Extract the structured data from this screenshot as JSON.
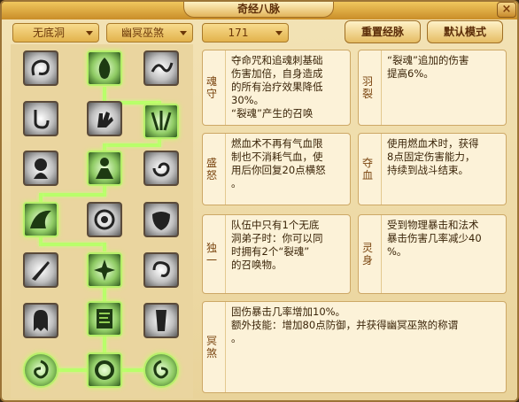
{
  "window": {
    "title": "奇经八脉",
    "close_glyph": "×"
  },
  "filters": [
    {
      "value": "无底洞"
    },
    {
      "value": "幽冥巫煞"
    },
    {
      "value": "171"
    }
  ],
  "buttons": {
    "reset": "重置经脉",
    "default_mode": "默认模式"
  },
  "cards": [
    {
      "label": "魂守",
      "lines": [
        "夺命咒和追魂刺基础",
        "伤害加倍，自身造成",
        "的所有治疗效果降低",
        "30%。",
        "“裂魂”产生的召唤"
      ]
    },
    {
      "label": "羽裂",
      "lines": [
        "“裂魂”追加的伤害",
        "提高6%。"
      ]
    },
    {
      "label": "盛怒",
      "lines": [
        "燃血术不再有气血限",
        "制也不消耗气血，使",
        "用后你回复20点横怒",
        "。"
      ]
    },
    {
      "label": "夺血",
      "lines": [
        "使用燃血术时，获得",
        "8点固定伤害能力，",
        "持续到战斗结束。"
      ]
    },
    {
      "label": "独一",
      "lines": [
        "队伍中只有1个无底",
        "洞弟子时：你可以同",
        "时拥有2个“裂魂”",
        "的召唤物。"
      ]
    },
    {
      "label": "灵身",
      "lines": [
        "受到物理暴击和法术",
        "暴击伤害几率减少40",
        "%。"
      ]
    },
    {
      "label": "冥煞",
      "lines": [
        "固伤暴击几率增加10%。",
        "额外技能：增加80点防御，并获得幽冥巫煞的称谓",
        "。"
      ]
    }
  ],
  "nodes": [
    {
      "name": "skill-r1-left",
      "active": false
    },
    {
      "name": "skill-r1-mid",
      "active": true
    },
    {
      "name": "skill-r1-right",
      "active": false
    },
    {
      "name": "skill-r2-left",
      "active": false
    },
    {
      "name": "skill-r2-mid",
      "active": false
    },
    {
      "name": "skill-r2-right",
      "active": true
    },
    {
      "name": "skill-r3-left",
      "active": false
    },
    {
      "name": "skill-r3-mid",
      "active": true
    },
    {
      "name": "skill-r3-right",
      "active": false
    },
    {
      "name": "skill-r4-left",
      "active": true
    },
    {
      "name": "skill-r4-mid",
      "active": false
    },
    {
      "name": "skill-r4-right",
      "active": false
    },
    {
      "name": "skill-r5-left",
      "active": false
    },
    {
      "name": "skill-r5-mid",
      "active": true
    },
    {
      "name": "skill-r5-right",
      "active": false
    },
    {
      "name": "skill-r6-left",
      "active": false
    },
    {
      "name": "skill-r6-mid",
      "active": true
    },
    {
      "name": "skill-r6-right",
      "active": false
    },
    {
      "name": "skill-r7-left",
      "active": true
    },
    {
      "name": "skill-r7-mid",
      "active": true
    },
    {
      "name": "skill-r7-right",
      "active": true
    }
  ],
  "colors": {
    "accent_green": "#b8ff6a",
    "panel_bg": "#fcf2d8",
    "text_brown": "#7a4510"
  }
}
